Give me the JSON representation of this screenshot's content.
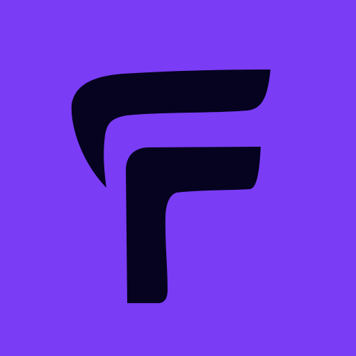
{
  "icon": {
    "name": "f-logo-icon",
    "background_color": "#7a3cf5",
    "mark_color": "#05031f"
  }
}
